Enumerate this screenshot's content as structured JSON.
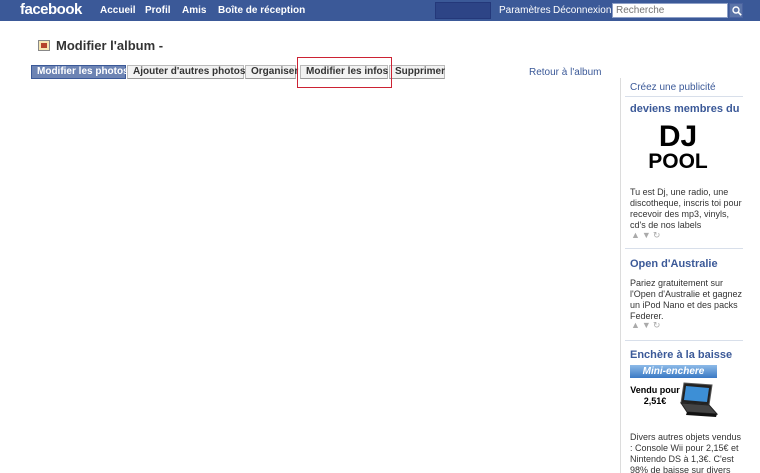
{
  "topbar": {
    "logo": "facebook",
    "nav": [
      "Accueil",
      "Profil",
      "Amis",
      "Boîte de réception"
    ],
    "settings": "Paramètres",
    "logout": "Déconnexion",
    "search_placeholder": "Recherche"
  },
  "page": {
    "title": "Modifier l'album -",
    "tabs": [
      "Modifier les photos",
      "Ajouter d'autres photos",
      "Organiser",
      "Modifier les infos",
      "Supprimer"
    ],
    "back_link": "Retour à l'album"
  },
  "sidebar": {
    "create_ad": "Créez une publicité",
    "ads": [
      {
        "title": "deviens membres du",
        "image_text_1": "DJ",
        "image_text_2": "POOL",
        "text": "Tu est Dj, une radio, une discotheque, inscris toi pour recevoir des mp3, vinyls, cd's de nos labels"
      },
      {
        "title": "Open d'Australie",
        "text": "Pariez gratuitement sur l'Open d'Australie et gagnez un iPod Nano et des packs Federer."
      },
      {
        "title": "Enchère à la baisse",
        "banner": "Mini-enchere",
        "price_line_1": "Vendu pour",
        "price_line_2": "2,51€",
        "text": "Divers autres objets vendus : Console Wii pour 2,15€ et Nintendo DS à 1,3€. C'est 98% de baisse sur divers"
      }
    ]
  },
  "colors": {
    "brand": "#3b5998",
    "active_tab": "#6d84b4",
    "highlight_box": "#cc2233"
  }
}
